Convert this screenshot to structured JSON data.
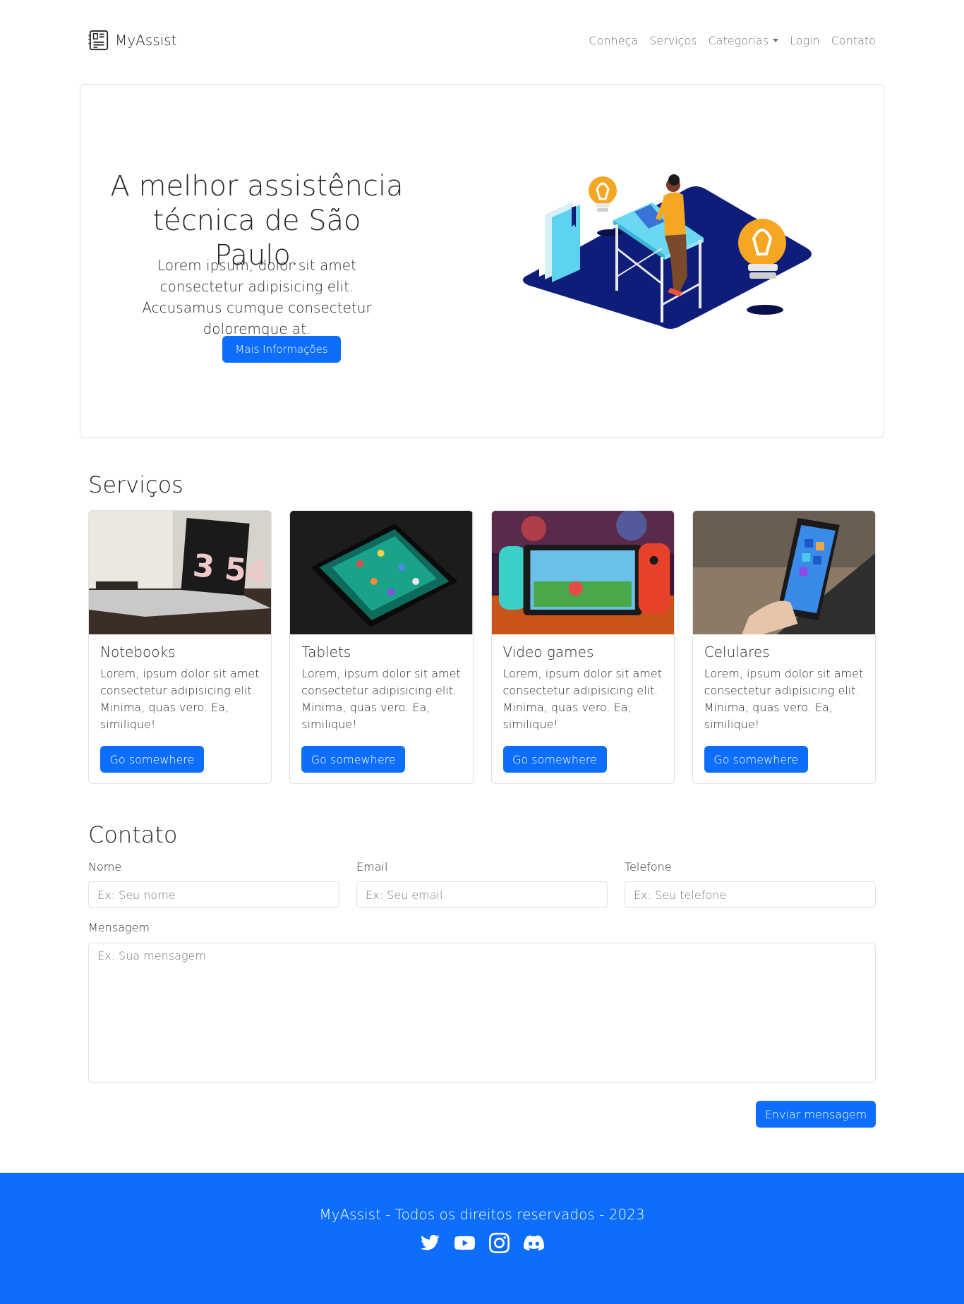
{
  "brand": {
    "name": "MyAssist",
    "icon": "motherboard-icon"
  },
  "nav": {
    "items": [
      {
        "label": "Conheça"
      },
      {
        "label": "Serviços"
      },
      {
        "label": "Categorias",
        "dropdown": true
      },
      {
        "label": "Login"
      },
      {
        "label": "Contato"
      }
    ]
  },
  "hero": {
    "title": "A melhor assistência técnica de São Paulo.",
    "text": "Lorem ipsum, dolor sit amet consectetur adipisicing elit. Accusamus cumque consectetur doloremque at.",
    "button": "Mais Informações",
    "illustration": "isometric-workspace-illustration"
  },
  "services": {
    "title": "Serviços",
    "cards": [
      {
        "title": "Notebooks",
        "text": "Lorem, ipsum dolor sit amet consectetur adipisicing elit. Minima, quas vero. Ea, similique!",
        "button": "Go somewhere",
        "image": "laptop-photo"
      },
      {
        "title": "Tablets",
        "text": "Lorem, ipsum dolor sit amet consectetur adipisicing elit. Minima, quas vero. Ea, similique!",
        "button": "Go somewhere",
        "image": "tablet-photo"
      },
      {
        "title": "Video games",
        "text": "Lorem, ipsum dolor sit amet consectetur adipisicing elit. Minima, quas vero. Ea, similique!",
        "button": "Go somewhere",
        "image": "nintendo-switch-photo"
      },
      {
        "title": "Celulares",
        "text": "Lorem, ipsum dolor sit amet consectetur adipisicing elit. Minima, quas vero. Ea, similique!",
        "button": "Go somewhere",
        "image": "smartphone-photo"
      }
    ]
  },
  "contact": {
    "title": "Contato",
    "fields": {
      "name": {
        "label": "Nome",
        "placeholder": "Ex: Seu nome",
        "value": ""
      },
      "email": {
        "label": "Email",
        "placeholder": "Ex: Seu email",
        "value": ""
      },
      "phone": {
        "label": "Telefone",
        "placeholder": "Ex: Seu telefone",
        "value": ""
      },
      "message": {
        "label": "Mensagem",
        "placeholder": "Ex: Sua mensagem",
        "value": ""
      }
    },
    "submit": "Enviar mensagem"
  },
  "footer": {
    "text": "MyAssist - Todos os direitos reservados - 2023",
    "social": [
      "twitter-icon",
      "youtube-icon",
      "instagram-icon",
      "discord-icon"
    ]
  },
  "colors": {
    "primary": "#0d6efd",
    "text": "#212529",
    "muted": "#6c757d",
    "border": "#dee2e6"
  }
}
